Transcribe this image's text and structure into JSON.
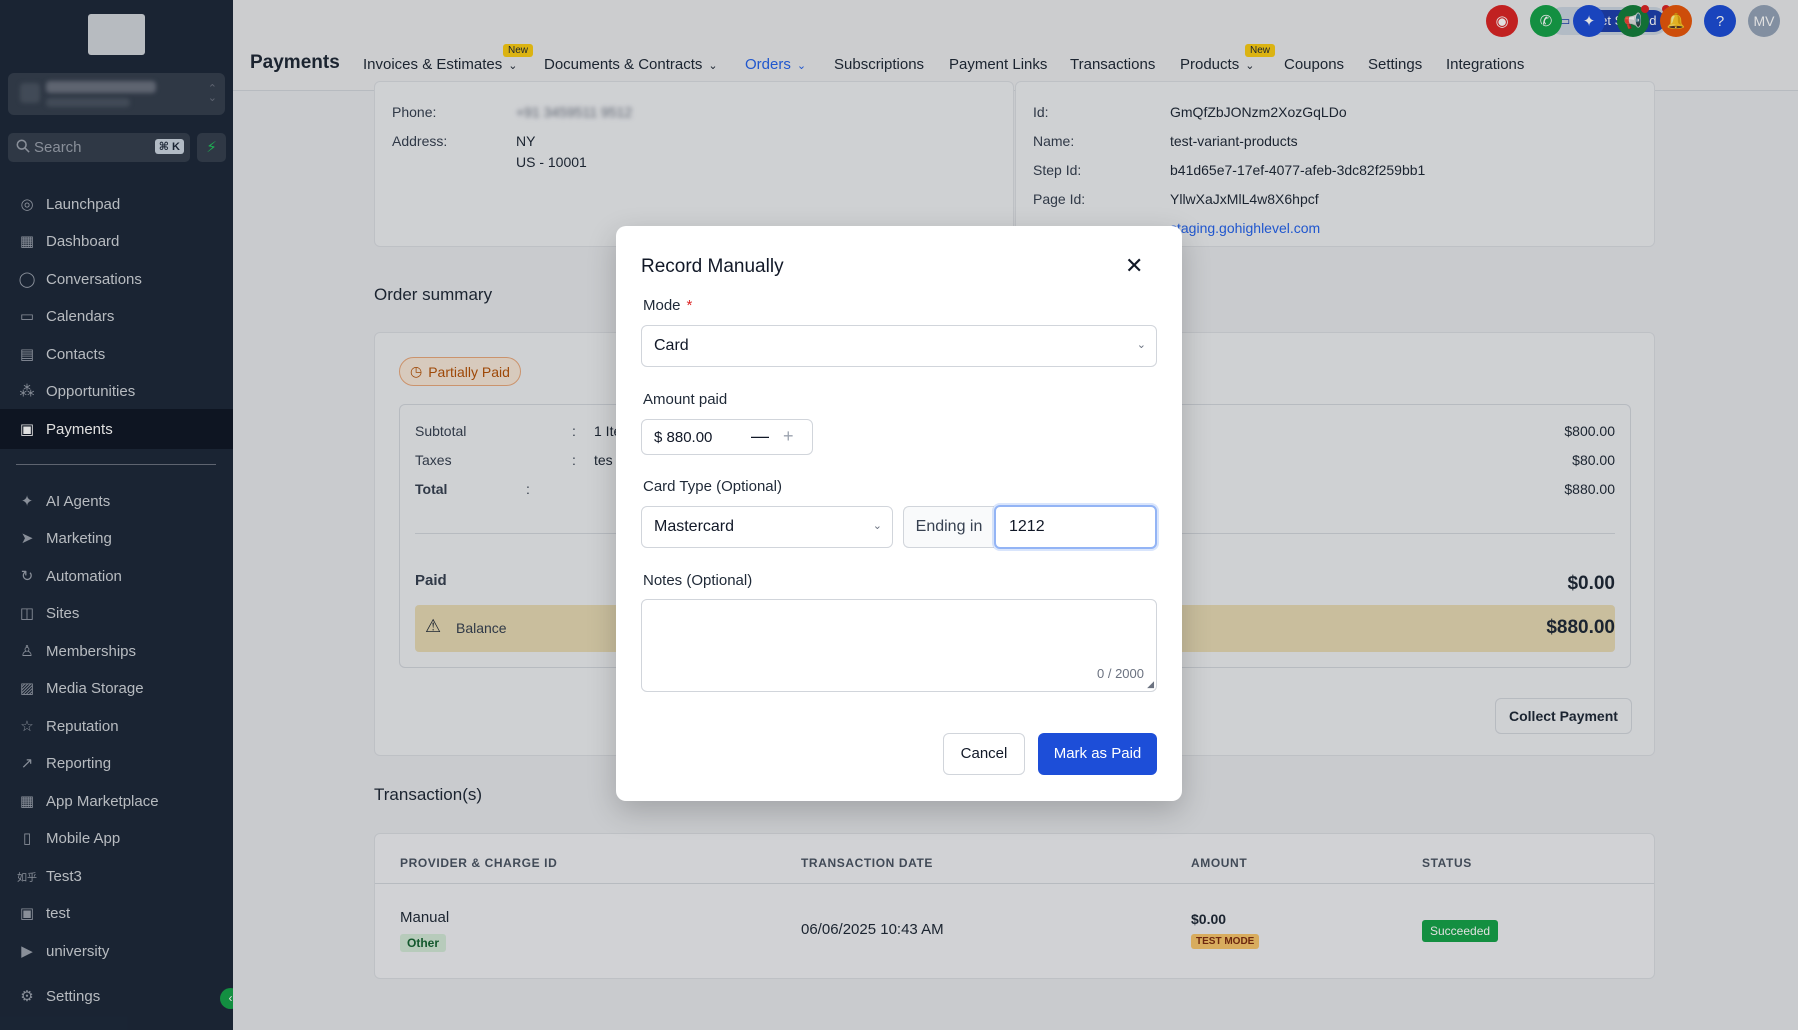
{
  "sidebar": {
    "search": {
      "placeholder": "Search",
      "shortcut": "⌘ K"
    },
    "items": [
      {
        "label": "Launchpad",
        "icon": "rocket-icon"
      },
      {
        "label": "Dashboard",
        "icon": "grid-icon"
      },
      {
        "label": "Conversations",
        "icon": "chat-icon"
      },
      {
        "label": "Calendars",
        "icon": "calendar-icon"
      },
      {
        "label": "Contacts",
        "icon": "contacts-icon"
      },
      {
        "label": "Opportunities",
        "icon": "opportunities-icon"
      },
      {
        "label": "Payments",
        "icon": "payments-icon",
        "active": true
      },
      {
        "label": "AI Agents",
        "icon": "sparkle-icon"
      },
      {
        "label": "Marketing",
        "icon": "send-icon"
      },
      {
        "label": "Automation",
        "icon": "automation-icon"
      },
      {
        "label": "Sites",
        "icon": "sites-icon"
      },
      {
        "label": "Memberships",
        "icon": "membership-icon"
      },
      {
        "label": "Media Storage",
        "icon": "image-icon"
      },
      {
        "label": "Reputation",
        "icon": "star-icon"
      },
      {
        "label": "Reporting",
        "icon": "trend-icon"
      },
      {
        "label": "App Marketplace",
        "icon": "apps-icon"
      },
      {
        "label": "Mobile App",
        "icon": "mobile-icon"
      },
      {
        "label": "Test3",
        "icon": "custom-icon"
      },
      {
        "label": "test",
        "icon": "square-icon"
      },
      {
        "label": "university",
        "icon": "video-icon"
      },
      {
        "label": "Settings",
        "icon": "gear-icon"
      }
    ]
  },
  "header": {
    "title": "Payments",
    "tabs": [
      {
        "label": "Invoices & Estimates",
        "badge": "New",
        "chevron": true
      },
      {
        "label": "Documents & Contracts",
        "chevron": true
      },
      {
        "label": "Orders",
        "chevron": true,
        "active": true
      },
      {
        "label": "Subscriptions"
      },
      {
        "label": "Payment Links"
      },
      {
        "label": "Transactions"
      },
      {
        "label": "Products",
        "badge": "New",
        "chevron": true
      },
      {
        "label": "Coupons"
      },
      {
        "label": "Settings"
      },
      {
        "label": "Integrations"
      }
    ],
    "get_started": "Get Started",
    "avatar": "MV",
    "colors": {
      "brand_blue": "#1e40af",
      "accent": "#2563eb"
    }
  },
  "customer": {
    "phone_label": "Phone:",
    "phone_value": "+91 3459511 9512",
    "address_label": "Address:",
    "address_line1": "NY",
    "address_line2": "US - 10001"
  },
  "funnel": {
    "id_label": "Id:",
    "id_value": "GmQfZbJONzm2XozGqLDo",
    "name_label": "Name:",
    "name_value": "test-variant-products",
    "step_label": "Step Id:",
    "step_value": "b41d65e7-17ef-4077-afeb-3dc82f259bb1",
    "page_label": "Page Id:",
    "page_value": "YllwXaJxMlL4w8X6hpcf",
    "domain_value": "staging.gohighlevel.com"
  },
  "order_summary": {
    "title": "Order summary",
    "status": "Partially Paid",
    "subtotal_label": "Subtotal",
    "subtotal_detail": "1 Ite",
    "subtotal_value": "$800.00",
    "taxes_label": "Taxes",
    "taxes_detail": "tes",
    "taxes_value": "$80.00",
    "total_label": "Total",
    "total_value": "$880.00",
    "colon": ":",
    "paid_label": "Paid",
    "paid_value": "$0.00",
    "balance_label": "Balance",
    "balance_value": "$880.00",
    "collect_button": "Collect Payment"
  },
  "transactions": {
    "title": "Transaction(s)",
    "columns": [
      "PROVIDER & CHARGE ID",
      "TRANSACTION DATE",
      "AMOUNT",
      "STATUS"
    ],
    "rows": [
      {
        "provider": "Manual",
        "provider_tag": "Other",
        "date": "06/06/2025 10:43 AM",
        "amount": "$0.00",
        "amount_tag": "TEST MODE",
        "status": "Succeeded"
      }
    ]
  },
  "modal": {
    "title": "Record Manually",
    "mode_label": "Mode",
    "mode_required": "*",
    "mode_value": "Card",
    "amount_label": "Amount paid",
    "amount_value": "$ 880.00",
    "card_type_label": "Card Type (Optional)",
    "card_type_value": "Mastercard",
    "ending_label": "Ending in",
    "ending_value": "1212",
    "notes_label": "Notes (Optional)",
    "notes_count": "0 / 2000",
    "cancel": "Cancel",
    "confirm": "Mark as Paid"
  }
}
